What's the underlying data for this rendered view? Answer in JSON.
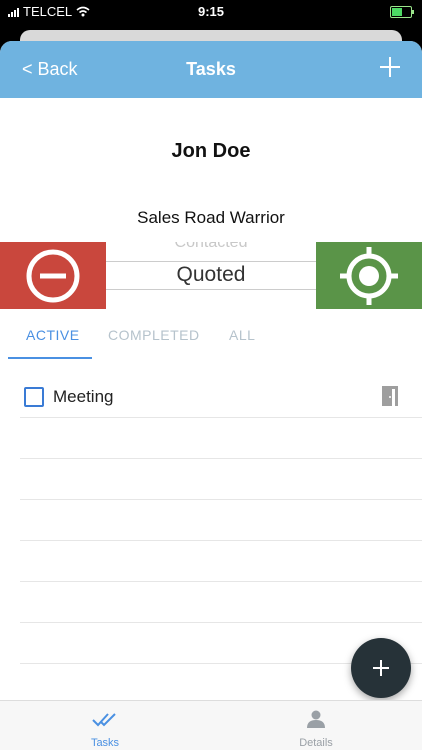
{
  "status_bar": {
    "carrier": "TELCEL",
    "time": "9:15"
  },
  "navbar": {
    "back_label": "< Back",
    "title": "Tasks"
  },
  "contact": {
    "name": "Jon Doe",
    "role": "Sales Road Warrior"
  },
  "stage_picker": {
    "previous": "Contacted",
    "current": "Quoted"
  },
  "tabs": [
    "ACTIVE",
    "COMPLETED",
    "ALL"
  ],
  "active_tab": "ACTIVE",
  "tasks": [
    {
      "label": "Meeting",
      "checked": false,
      "icon": "door-icon"
    }
  ],
  "tab_bar": {
    "items": [
      {
        "label": "Tasks",
        "icon": "double-check-icon"
      },
      {
        "label": "Details",
        "icon": "person-icon"
      }
    ]
  },
  "colors": {
    "nav": "#6fb3e0",
    "accent": "#4a90e2",
    "swipe_left": "#c9473d",
    "swipe_right": "#5a9448",
    "fab": "#263238"
  }
}
